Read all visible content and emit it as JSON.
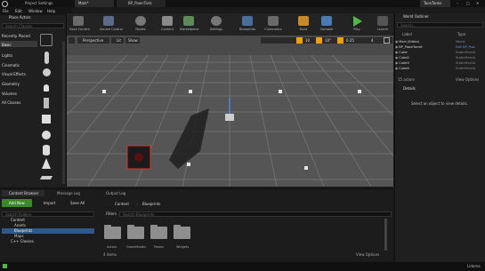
{
  "titlebar": {
    "project_tab": "Project Settings",
    "main_tab": "Main*",
    "bp_tab": "BP_PawnTank",
    "project_name": "ToonTanks"
  },
  "menu": [
    "File",
    "Edit",
    "Window",
    "Help"
  ],
  "place_actors": {
    "title": "Place Actors",
    "search_placeholder": "Search Classes",
    "categories": [
      "Recently Placed",
      "Basic",
      "Lights",
      "Cinematic",
      "Visual Effects",
      "Geometry",
      "Volumes",
      "All Classes"
    ]
  },
  "toolbar": [
    "Save Current",
    "Source Control",
    "Modes",
    "Content",
    "Marketplace",
    "Settings",
    "Blueprints",
    "Cinematics",
    "Build",
    "Compile",
    "Play",
    "Launch"
  ],
  "viewport": {
    "perspective": "Perspective",
    "lit": "Lit",
    "show": "Show",
    "grid_snap": "10",
    "rot_snap": "10°",
    "scale_snap": "0.25",
    "cam_speed": "4"
  },
  "outliner": {
    "title": "World Outliner",
    "search_placeholder": "Search...",
    "col_label": "Label",
    "col_type": "Type",
    "rows": [
      {
        "label": "Main (Editor)",
        "type": "World"
      },
      {
        "label": "BP_PawnTurret",
        "type": "Edit BP_Paw"
      },
      {
        "label": "Cube",
        "type": "StaticMeshA"
      },
      {
        "label": "Cube2",
        "type": "StaticMeshA"
      },
      {
        "label": "Cube3",
        "type": "StaticMeshA"
      },
      {
        "label": "Cube4",
        "type": "StaticMeshA"
      }
    ],
    "actors_count": "15 actors",
    "view_options": "View Options"
  },
  "details": {
    "title": "Details",
    "empty": "Select an object to view details."
  },
  "content_browser": {
    "tabs": [
      "Content Browser",
      "Message Log",
      "Output Log"
    ],
    "add_new": "Add New",
    "import": "Import",
    "save_all": "Save All",
    "breadcrumb": [
      "Content",
      "Blueprints"
    ],
    "search_folders": "Search Folders",
    "filters": "Filters",
    "search_assets": "Search Blueprints",
    "tree": [
      "Content",
      "Assets",
      "Blueprints",
      "Maps",
      "C++ Classes"
    ],
    "folders": [
      "Actors",
      "GameModes",
      "Pawns",
      "Widgets"
    ],
    "items_count": "4 items",
    "view_options": "View Options"
  },
  "statusbar": {
    "mode": "Lidoma"
  },
  "colors": {
    "accent": "#f0a000",
    "blue": "#2a5a8e",
    "select": "#2e5a8a"
  }
}
